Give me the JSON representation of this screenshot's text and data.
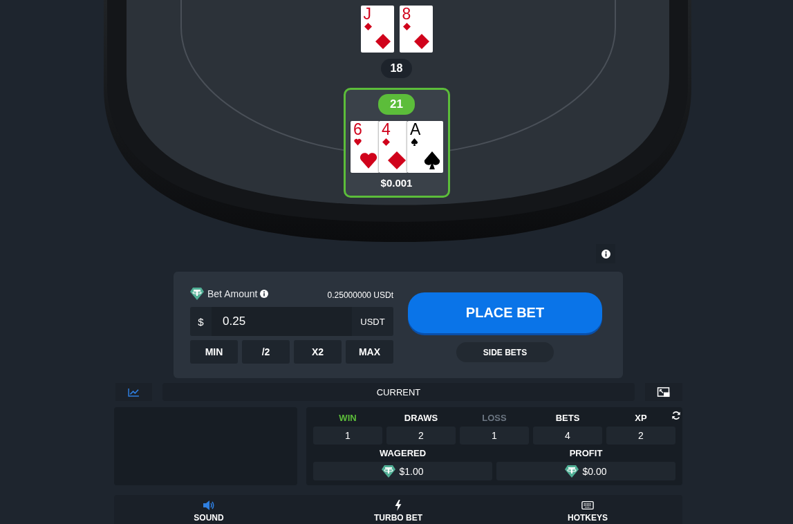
{
  "dealer": {
    "cards": [
      {
        "rank": "J",
        "kind": "diamonds"
      },
      {
        "rank": "8",
        "kind": "diamonds"
      }
    ],
    "total": "18"
  },
  "player": {
    "highlighted": true,
    "total": "21",
    "cards": [
      {
        "rank": "6",
        "kind": "hearts"
      },
      {
        "rank": "4",
        "kind": "diamonds"
      },
      {
        "rank": "A",
        "kind": "spades"
      }
    ],
    "bet": "$0.001"
  },
  "bet_panel": {
    "label": "Bet Amount",
    "balance": "0.25000000 USDt",
    "prefix": "$",
    "value": "0.25",
    "currency": "USDT",
    "quick_buttons": [
      "MIN",
      "/2",
      "X2",
      "MAX"
    ],
    "place_bet": "PLACE BET",
    "side_bets": "SIDE BETS"
  },
  "stats_tab": "CURRENT",
  "stats": [
    {
      "label": "WIN",
      "kind": "win",
      "value": "1"
    },
    {
      "label": "DRAWS",
      "kind": "neutral",
      "value": "2"
    },
    {
      "label": "LOSS",
      "kind": "loss",
      "value": "1"
    },
    {
      "label": "BETS",
      "kind": "neutral",
      "value": "4"
    },
    {
      "label": "XP",
      "kind": "neutral",
      "value": "2"
    }
  ],
  "totals": [
    {
      "label": "WAGERED",
      "value": "$1.00"
    },
    {
      "label": "PROFIT",
      "value": "$0.00"
    }
  ],
  "toolbar": [
    {
      "label": "SOUND",
      "on": true
    },
    {
      "label": "TURBO BET",
      "on": false
    },
    {
      "label": "HOTKEYS",
      "on": false
    }
  ]
}
